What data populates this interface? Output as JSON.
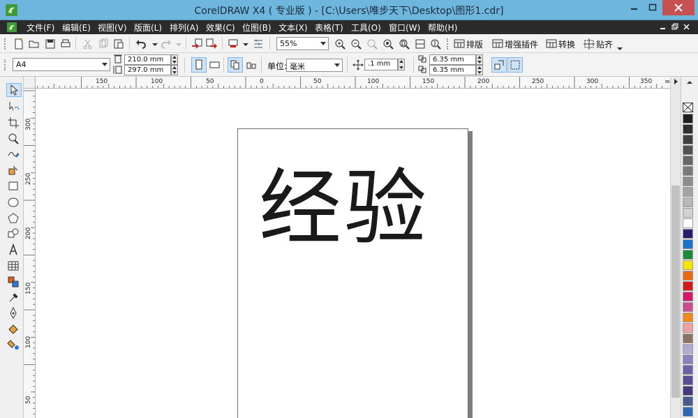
{
  "window": {
    "title": "CorelDRAW X4 ( 专业版 ) - [C:\\Users\\唯步天下\\Desktop\\图形1.cdr]"
  },
  "menu": [
    {
      "name": "menu-file",
      "label": "文件(F)"
    },
    {
      "name": "menu-edit",
      "label": "编辑(E)"
    },
    {
      "name": "menu-view",
      "label": "视图(V)"
    },
    {
      "name": "menu-layout",
      "label": "版面(L)"
    },
    {
      "name": "menu-arrange",
      "label": "排列(A)"
    },
    {
      "name": "menu-effects",
      "label": "效果(C)"
    },
    {
      "name": "menu-bitmaps",
      "label": "位图(B)"
    },
    {
      "name": "menu-text",
      "label": "文本(X)"
    },
    {
      "name": "menu-table",
      "label": "表格(T)"
    },
    {
      "name": "menu-tools",
      "label": "工具(O)"
    },
    {
      "name": "menu-window",
      "label": "窗口(W)"
    },
    {
      "name": "menu-help",
      "label": "帮助(H)"
    }
  ],
  "standard_toolbar": {
    "zoom_level": "55%",
    "group_buttons": [
      {
        "name": "paiban-button",
        "label": "排版"
      },
      {
        "name": "plugins-button",
        "label": "增强插件"
      },
      {
        "name": "convert-button",
        "label": "转换"
      },
      {
        "name": "snap-button",
        "label": "贴齐"
      }
    ]
  },
  "property_bar": {
    "paper_size": "A4",
    "width": "210.0 mm",
    "height": "297.0 mm",
    "units_label": "单位:",
    "units_value": "毫米",
    "nudge": ".1 mm",
    "dup_x": "6.35 mm",
    "dup_y": "6.35 mm"
  },
  "rulers": {
    "horizontal_labels": [
      "150",
      "100",
      "50",
      "0",
      "50",
      "100",
      "150",
      "200",
      "250",
      "300",
      "350"
    ],
    "vertical_labels": [
      "300",
      "250",
      "200",
      "150",
      "100",
      "50"
    ],
    "corner_glyph": "≈"
  },
  "document": {
    "text": "经验"
  },
  "palette": {
    "colors": [
      "#1f1f1f",
      "#2f2f2f",
      "#404040",
      "#525252",
      "#666666",
      "#7a7a7a",
      "#8e8e8e",
      "#a3a3a3",
      "#b8b8b8",
      "#d1d1d1",
      "#ffffff",
      "#2b1b70",
      "#1e73c9",
      "#1a8a3b",
      "#f3e600",
      "#e86a10",
      "#d41a1a",
      "#d6166c",
      "#c94d8a",
      "#f08a1c",
      "#f0a0a0",
      "#8c7264",
      "#b5a9d4",
      "#8e80be",
      "#6f5fa8",
      "#5a4b95",
      "#46387e",
      "#4a5a8c",
      "#2f68b0"
    ]
  }
}
